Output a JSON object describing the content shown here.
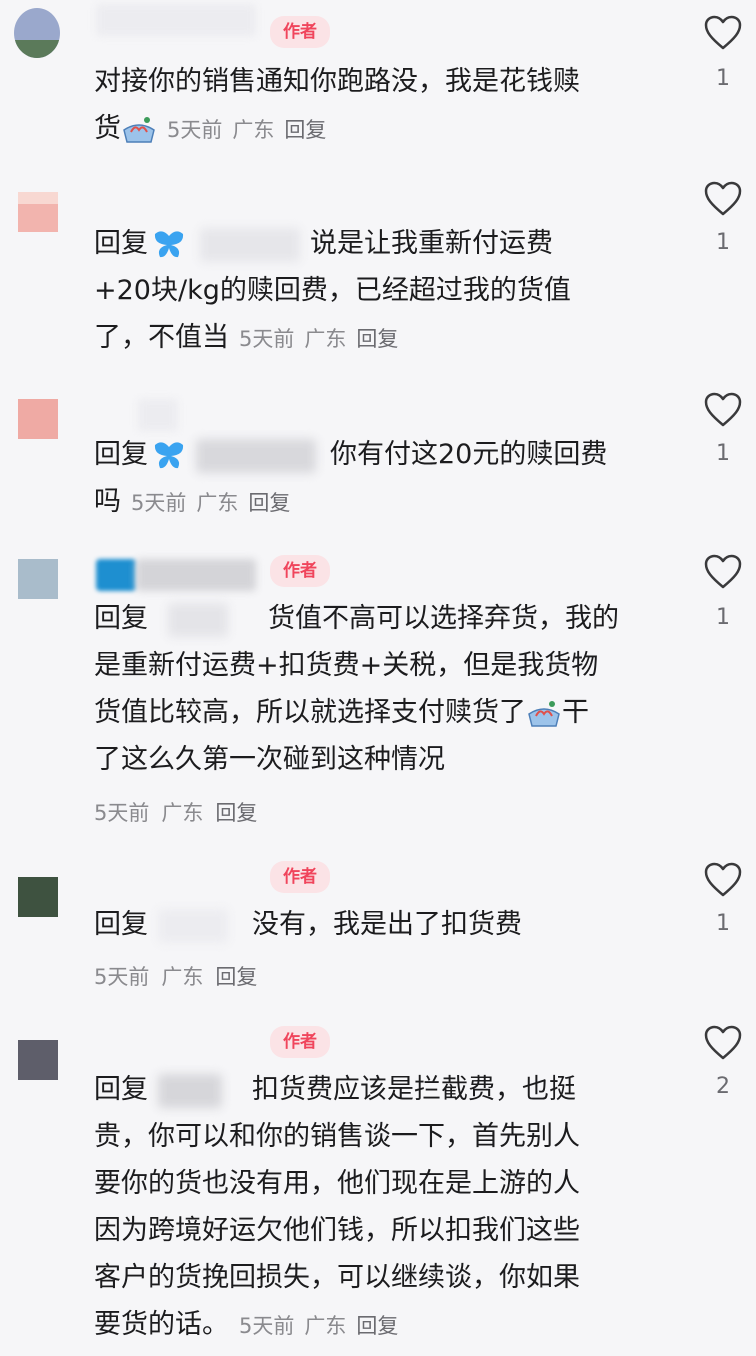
{
  "author_badge": "作者",
  "colors": {
    "badge_bg": "#fbe3e6",
    "badge_text": "#f0455c",
    "meta": "#8a8a8e",
    "butterfly": "#3aa3f0"
  },
  "comments": [
    {
      "lines": [
        "对接你的销售通知你跑路没，我是花钱赎",
        "货"
      ],
      "time": "5天前",
      "location": "广东",
      "reply": "回复",
      "likes": "1"
    },
    {
      "reply_prefix": "回复",
      "lines": [
        "说是让我重新付运费",
        "+20块/kg的赎回费，已经超过我的货值",
        "了，不值当"
      ],
      "time": "5天前",
      "location": "广东",
      "reply": "回复",
      "likes": "1"
    },
    {
      "reply_prefix": "回复",
      "lines": [
        "你有付这20元的赎回费",
        "吗"
      ],
      "time": "5天前",
      "location": "广东",
      "reply": "回复",
      "likes": "1"
    },
    {
      "reply_prefix": "回复",
      "lines": [
        "货值不高可以选择弃货，我的",
        "是重新付运费+扣货费+关税，但是我货物",
        "货值比较高，所以就选择支付赎货了",
        "干",
        "了这么久第一次碰到这种情况"
      ],
      "time": "5天前",
      "location": "广东",
      "reply": "回复",
      "likes": "1"
    },
    {
      "reply_prefix": "回复",
      "lines": [
        "没有，我是出了扣货费"
      ],
      "time": "5天前",
      "location": "广东",
      "reply": "回复",
      "likes": "1"
    },
    {
      "reply_prefix": "回复",
      "lines": [
        "扣货费应该是拦截费，也挺",
        "贵，你可以和你的销售谈一下，首先别人",
        "要你的货也没有用，他们现在是上游的人",
        "因为跨境好运欠他们钱，所以扣我们这些",
        "客户的货挽回损失，可以继续谈，你如果",
        "要货的话。"
      ],
      "time": "5天前",
      "location": "广东",
      "reply": "回复",
      "likes": "2"
    }
  ]
}
